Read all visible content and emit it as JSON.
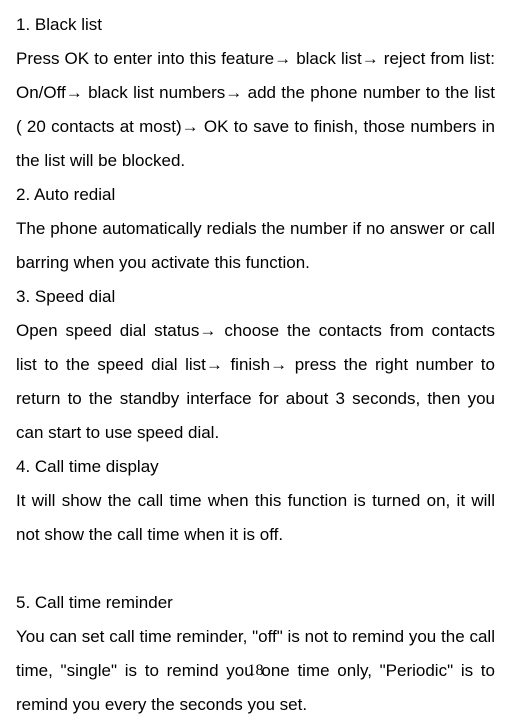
{
  "sections": {
    "s1": {
      "title": "1. Black list",
      "body": "Press OK to enter into this feature→ black list→ reject from list: On/Off→ black list numbers→ add the phone number to the list ( 20 contacts at most)→ OK to save to finish, those numbers in the list will be blocked."
    },
    "s2": {
      "title": "2. Auto redial",
      "body": "The phone automatically redials the number if no answer or call barring when you activate this function."
    },
    "s3": {
      "title": "3. Speed dial",
      "body": "Open speed dial status→ choose the contacts from contacts list to the speed dial list→ finish→ press the right number to return to the standby interface for about 3 seconds, then you can start to use speed dial."
    },
    "s4": {
      "title": "4. Call time display",
      "body": "It will show the call time when this function is turned on, it will not show the call time when it is off."
    },
    "s5": {
      "title": "5. Call time reminder",
      "body": "You can set call time reminder, \"off\" is not to remind you the call time, \"single\" is to remind you one time only, \"Periodic\" is to remind you every the seconds you set."
    }
  },
  "page_number": "18"
}
